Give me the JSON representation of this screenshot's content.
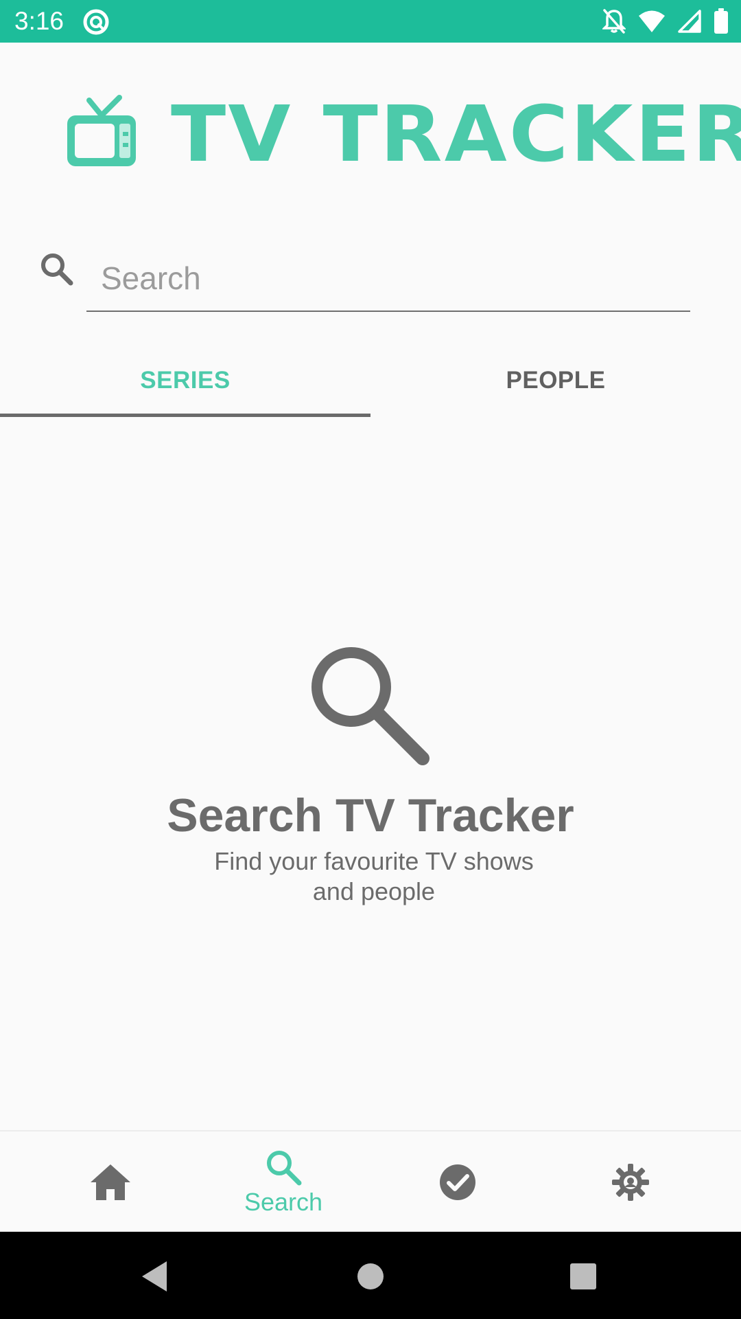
{
  "status_bar": {
    "time": "3:16",
    "background_color": "#1dbd9a",
    "left_icon": "sync-circle-icon",
    "right_icons": [
      "notifications-off-icon",
      "wifi-icon",
      "cellular-signal-icon",
      "battery-icon"
    ]
  },
  "app": {
    "title": "TV TRACKER",
    "logo_icon": "tv-icon",
    "accent_color": "#4ccaaa"
  },
  "search": {
    "placeholder": "Search",
    "value": "",
    "icon": "search-icon"
  },
  "tabs": [
    {
      "label": "SERIES",
      "selected": true
    },
    {
      "label": "PEOPLE",
      "selected": false
    }
  ],
  "empty_state": {
    "icon": "search-icon",
    "title": "Search TV Tracker",
    "subtitle": "Find your favourite TV shows and people"
  },
  "bottom_nav": {
    "items": [
      {
        "icon": "home-icon",
        "label": "",
        "selected": false
      },
      {
        "icon": "search-icon",
        "label": "Search",
        "selected": true
      },
      {
        "icon": "check-circle-icon",
        "label": "",
        "selected": false
      },
      {
        "icon": "settings-icon",
        "label": "",
        "selected": false
      }
    ]
  },
  "system_nav": {
    "buttons": [
      "back-icon",
      "home-circle-icon",
      "recents-square-icon"
    ]
  }
}
